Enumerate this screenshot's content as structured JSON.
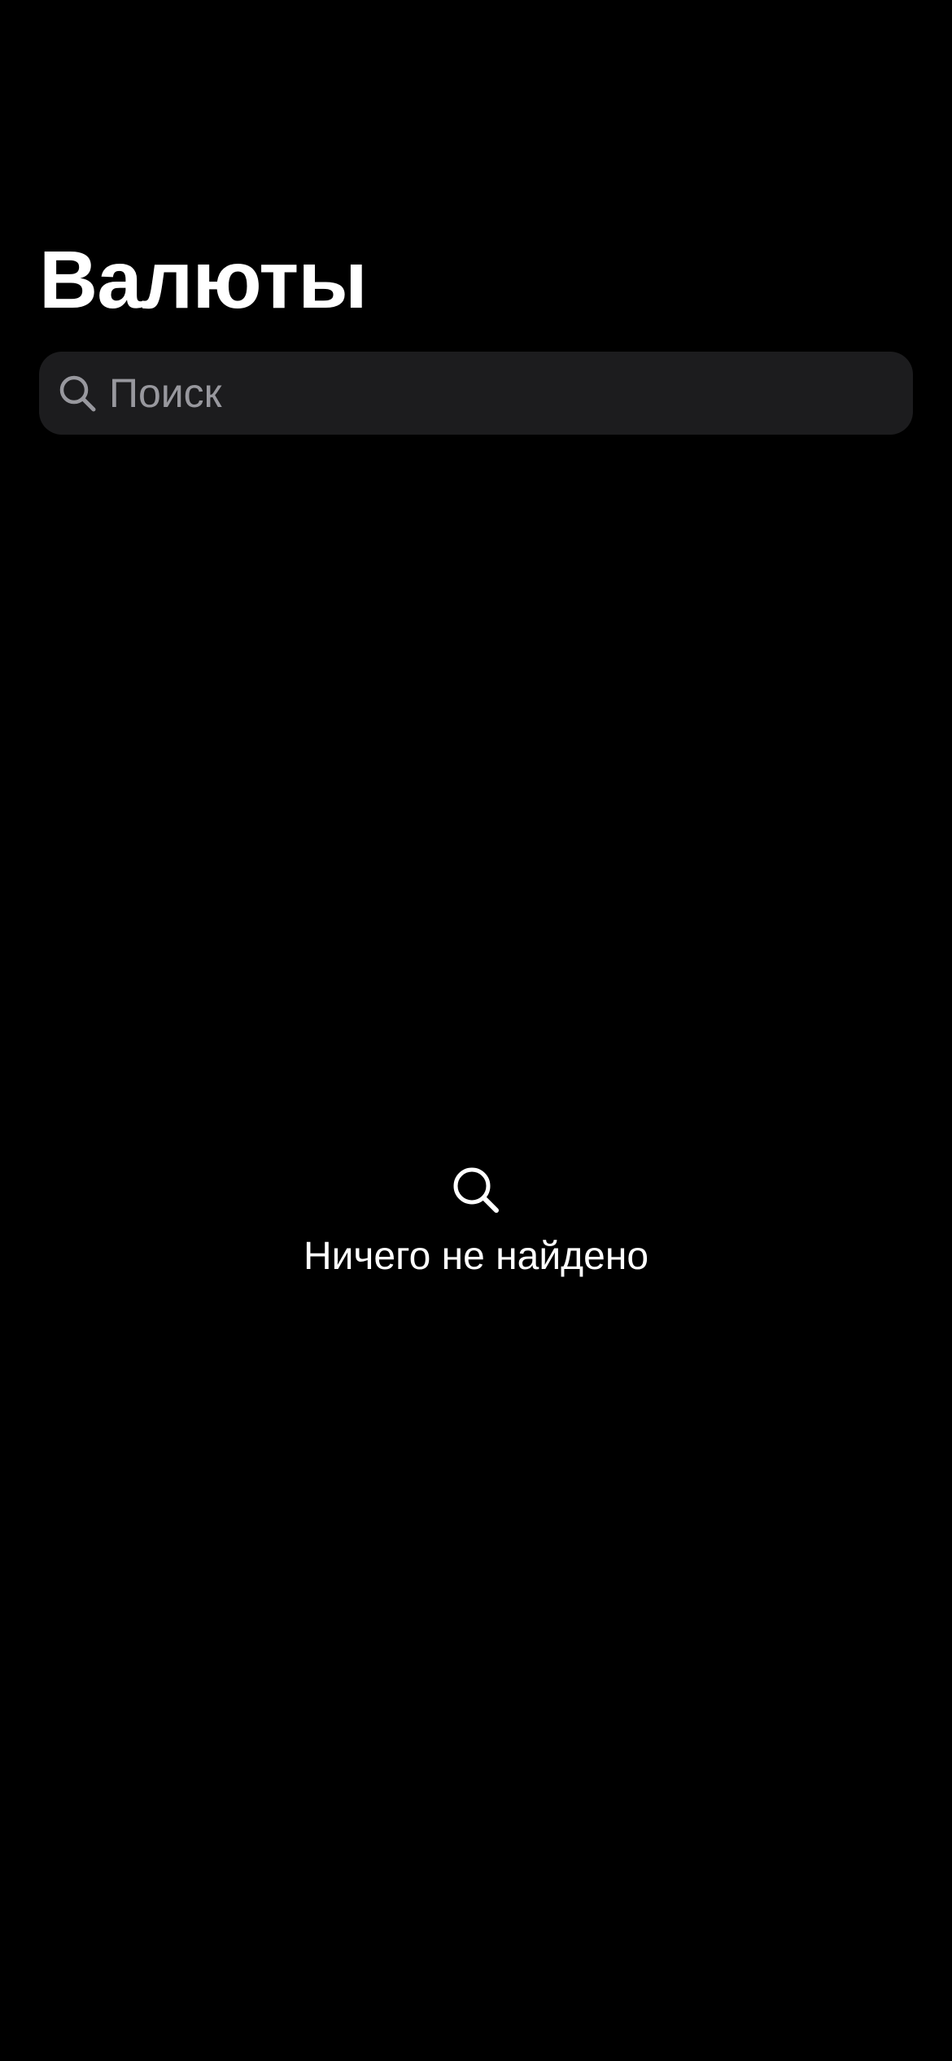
{
  "header": {
    "title": "Валюты"
  },
  "search": {
    "placeholder": "Поиск",
    "value": "",
    "icon": "search-icon"
  },
  "empty_state": {
    "icon": "search-icon",
    "message": "Ничего не найдено"
  },
  "colors": {
    "background": "#000000",
    "search_field": "#1c1c1e",
    "placeholder": "#98989e",
    "text": "#ffffff"
  }
}
